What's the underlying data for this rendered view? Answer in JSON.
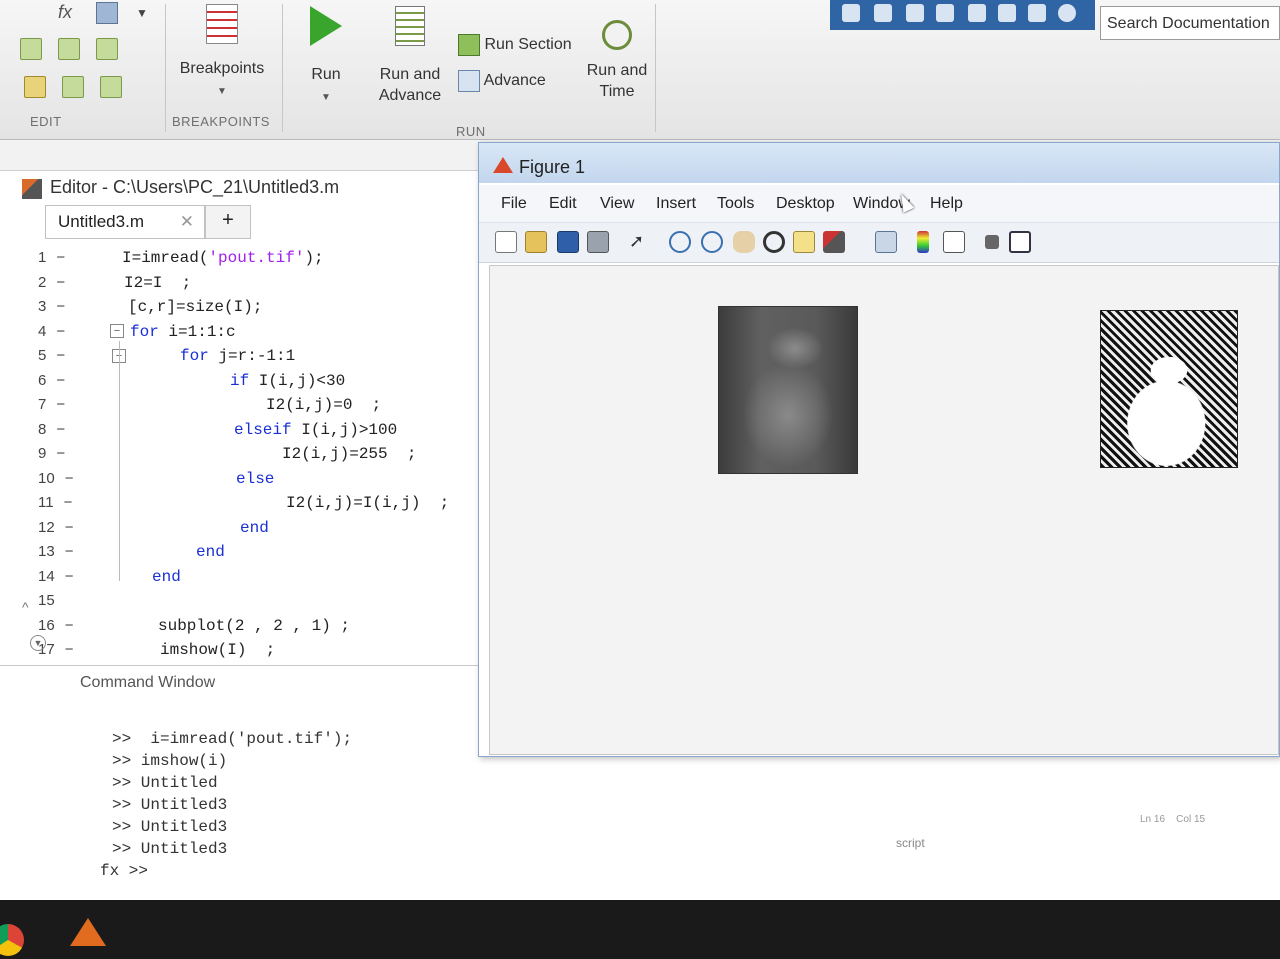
{
  "toolstrip": {
    "sections": {
      "edit": "EDIT",
      "breakpoints": "BREAKPOINTS",
      "run": "RUN"
    },
    "breakpoints_label": "Breakpoints",
    "run_label": "Run",
    "run_and_advance_label_1": "Run and",
    "run_and_advance_label_2": "Advance",
    "run_section_label": "Run Section",
    "advance_label": "Advance",
    "run_and_time_label_1": "Run and",
    "run_and_time_label_2": "Time",
    "fx_label": "fx"
  },
  "search": {
    "placeholder": "Search Documentation"
  },
  "editor": {
    "title": "Editor - C:\\Users\\PC_21\\Untitled3.m",
    "tab_label": "Untitled3.m",
    "tab_add": "+",
    "lines": [
      {
        "n": "1",
        "dash": "−"
      },
      {
        "n": "2",
        "dash": "−"
      },
      {
        "n": "3",
        "dash": "−"
      },
      {
        "n": "4",
        "dash": "−"
      },
      {
        "n": "5",
        "dash": "−"
      },
      {
        "n": "6",
        "dash": "−"
      },
      {
        "n": "7",
        "dash": "−"
      },
      {
        "n": "8",
        "dash": "−"
      },
      {
        "n": "9",
        "dash": "−"
      },
      {
        "n": "10",
        "dash": "−"
      },
      {
        "n": "11",
        "dash": "−"
      },
      {
        "n": "12",
        "dash": "−"
      },
      {
        "n": "13",
        "dash": "−"
      },
      {
        "n": "14",
        "dash": "−"
      },
      {
        "n": "15",
        "dash": ""
      },
      {
        "n": "16",
        "dash": "−"
      },
      {
        "n": "17",
        "dash": "−"
      }
    ],
    "code": {
      "l1_a": "I=imread(",
      "l1_str": "'pout.tif'",
      "l1_b": ");",
      "l2": "I2=I  ;",
      "l3": "[c,r]=size(I);",
      "l4_kw": "for",
      "l4": " i=1:1:c",
      "l5_kw": "for",
      "l5": " j=r:-1:1",
      "l6_kw": "if",
      "l6": " I(i,j)<30",
      "l7": "I2(i,j)=0  ;",
      "l8_kw": "elseif",
      "l8": " I(i,j)>100",
      "l9": "I2(i,j)=255  ;",
      "l10_kw": "else",
      "l11": "I2(i,j)=I(i,j)  ;",
      "l12_kw": "end",
      "l13_kw": "end",
      "l14_kw": "end",
      "l16": "subplot(2 , 2 , 1) ;",
      "l17": "imshow(I)  ;"
    }
  },
  "command_window": {
    "title": "Command Window",
    "lines": [
      ">>  i=imread('pout.tif');",
      ">> imshow(i)",
      ">> Untitled",
      ">> Untitled3",
      ">> Untitled3",
      ">> Untitled3"
    ],
    "prompt": "fx >>",
    "status_ln": "Ln  16",
    "status_col": "Col  15",
    "status_script": "script"
  },
  "figure": {
    "title": "Figure 1",
    "menu": [
      "File",
      "Edit",
      "View",
      "Insert",
      "Tools",
      "Desktop",
      "Window",
      "Help"
    ]
  },
  "colors": {
    "keyword": "#1a2fd6",
    "string": "#a020f0",
    "run_green": "#3aa52c"
  }
}
